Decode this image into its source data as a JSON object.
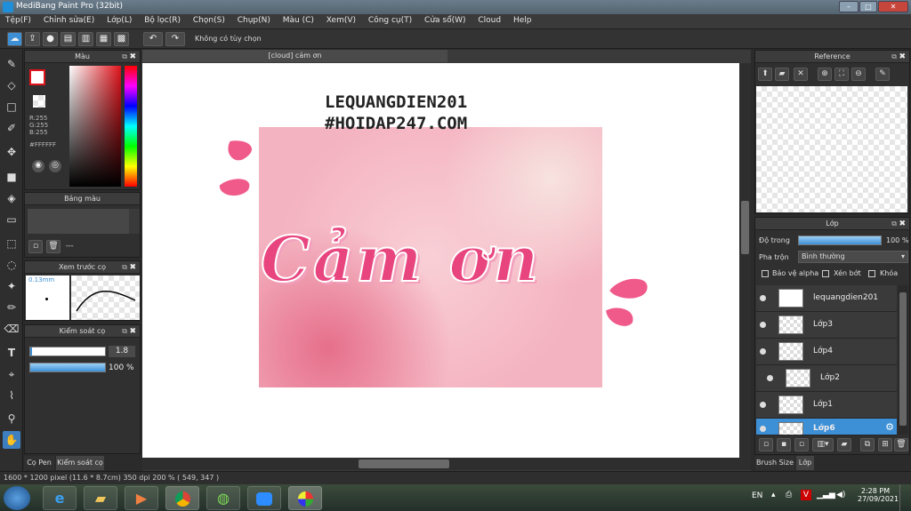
{
  "window": {
    "title": "MediBang Paint Pro (32bit)",
    "controls": [
      "–",
      "□",
      "✕"
    ]
  },
  "menu": [
    "Tệp(F)",
    "Chỉnh sửa(E)",
    "Lớp(L)",
    "Bộ lọc(R)",
    "Chọn(S)",
    "Chụp(N)",
    "Màu (C)",
    "Xem(V)",
    "Công cụ(T)",
    "Cửa sổ(W)",
    "Cloud",
    "Help"
  ],
  "toolbar": {
    "no_options": "Không có tùy chọn"
  },
  "color_panel": {
    "title": "Màu",
    "r": "R:255",
    "g": "G:255",
    "b": "B:255",
    "hex": "#FFFFFF"
  },
  "palette_panel": {
    "title": "Bảng màu",
    "dashes": "---"
  },
  "preview_panel": {
    "title": "Xem trước cọ",
    "size": "0.13mm"
  },
  "brush_control": {
    "title": "Kiểm soát cọ",
    "size_value": "1.8",
    "opacity_value": "100 %",
    "opacity_fraction": 1.0
  },
  "left_tabs": {
    "pen_tab": "Cọ Pen",
    "control_tab": "Kiểm soát cọ"
  },
  "canvas": {
    "tab_title": "[cloud] cảm ơn",
    "watermark_line1": "LEQUANGDIEN201",
    "watermark_line2": "#HOIDAP247.COM",
    "artwork_text": "Cảm ơn"
  },
  "reference_panel": {
    "title": "Reference"
  },
  "layer_panel": {
    "title": "Lớp",
    "opacity_label": "Độ trong",
    "opacity_value": "100 %",
    "opacity_fraction": 1.0,
    "blend_label": "Pha trộn",
    "blend_value": "Bình thường",
    "protect_alpha": "Bảo vệ alpha",
    "clipping": "Xén bớt",
    "lock": "Khóa",
    "layers": [
      {
        "name": "lequangdien201",
        "selected": false
      },
      {
        "name": "Lớp3",
        "selected": false
      },
      {
        "name": "Lớp4",
        "selected": false
      },
      {
        "name": "Lớp2",
        "selected": false
      },
      {
        "name": "Lớp1",
        "selected": false
      },
      {
        "name": "Lớp6",
        "selected": true
      }
    ]
  },
  "right_tabs": {
    "brush_size": "Brush Size",
    "layer": "Lớp"
  },
  "status": {
    "dimensions": "1600 * 1200 pixel",
    "physical": "(11.6 * 8.7cm)",
    "dpi": "350 dpi",
    "zoom": "200 %",
    "cursor": "( 549, 347 )"
  },
  "taskbar": {
    "lang": "EN",
    "time": "2:28 PM",
    "date": "27/09/2021"
  },
  "colors": {
    "accent": "#3d8fd6",
    "primary_color": "#e0141c",
    "artwork_pink": "#e8457f"
  }
}
